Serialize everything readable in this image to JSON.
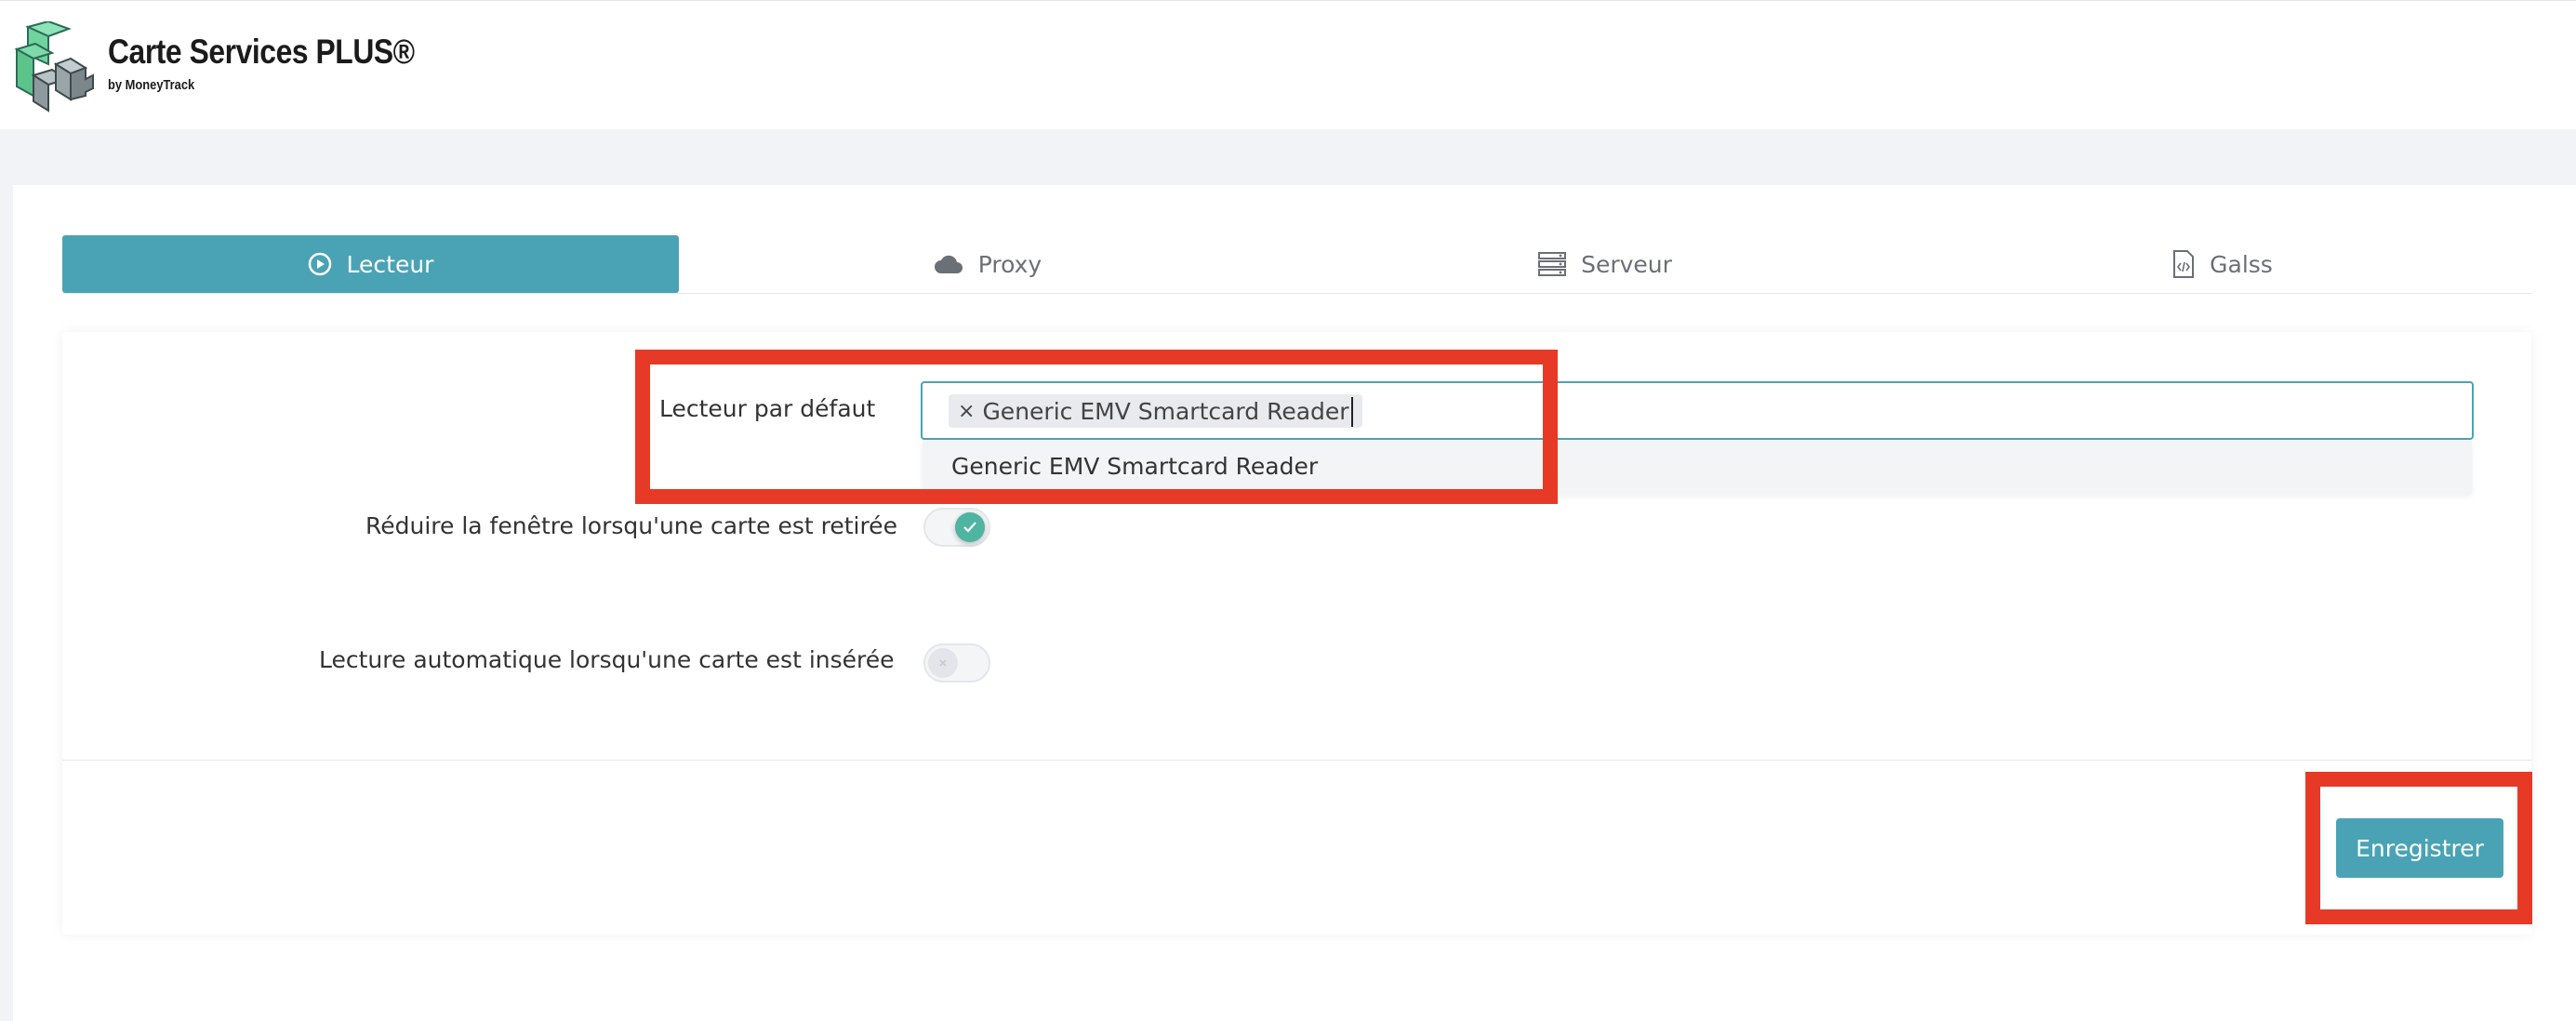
{
  "brand": {
    "title": "Carte Services PLUS®",
    "subtitle": "by MoneyTrack",
    "logo_icon": "csp-cube-logo-icon"
  },
  "tabs": [
    {
      "label": "Lecteur",
      "icon": "play-circle-icon",
      "active": true
    },
    {
      "label": "Proxy",
      "icon": "cloud-icon",
      "active": false
    },
    {
      "label": "Serveur",
      "icon": "server-icon",
      "active": false
    },
    {
      "label": "Galss",
      "icon": "code-file-icon",
      "active": false
    }
  ],
  "settings": {
    "default_reader": {
      "label": "Lecteur par défaut",
      "selected_chip": "Generic EMV Smartcard Reader",
      "remove_symbol": "×",
      "dropdown_options": [
        "Generic EMV Smartcard Reader"
      ]
    },
    "minimize_on_removal": {
      "label": "Réduire la fenêtre lorsqu'une carte est retirée",
      "enabled": true
    },
    "autoread_on_insert": {
      "label": "Lecture automatique lorsqu'une carte est insérée",
      "enabled": false
    }
  },
  "actions": {
    "save_label": "Enregistrer"
  },
  "colors": {
    "accent": "#4aa3b4",
    "toggle_on": "#4fb4a1",
    "highlight": "#e63a27"
  }
}
